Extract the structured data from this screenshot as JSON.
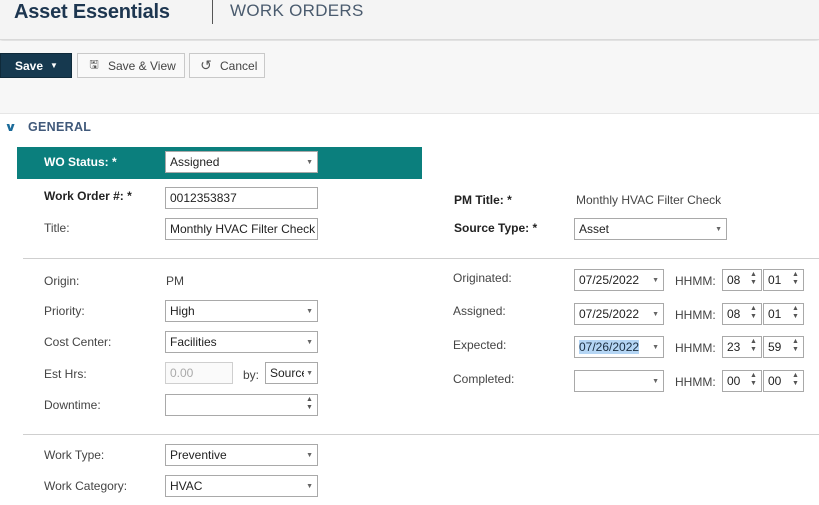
{
  "header": {
    "brand": "Asset Essentials",
    "module": "WORK ORDERS"
  },
  "toolbar": {
    "save": "Save",
    "save_view": "Save & View",
    "cancel": "Cancel"
  },
  "section": {
    "title": "GENERAL"
  },
  "form": {
    "wo_status": {
      "label": "WO Status: *",
      "value": "Assigned"
    },
    "work_order_no": {
      "label": "Work Order #: *",
      "value": "0012353837"
    },
    "title": {
      "label": "Title:",
      "value": "Monthly HVAC Filter Check"
    },
    "pm_title": {
      "label": "PM Title: *",
      "value": "Monthly HVAC Filter Check"
    },
    "source_type": {
      "label": "Source Type: *",
      "value": "Asset"
    },
    "origin": {
      "label": "Origin:",
      "value": "PM"
    },
    "priority": {
      "label": "Priority:",
      "value": "High"
    },
    "cost_center": {
      "label": "Cost Center:",
      "value": "Facilities"
    },
    "est_hrs": {
      "label": "Est Hrs:",
      "placeholder": "0.00",
      "by_label": "by:",
      "by_value": "Source"
    },
    "downtime": {
      "label": "Downtime:",
      "value": ""
    },
    "originated": {
      "label": "Originated:",
      "date": "07/25/2022",
      "hhmm_label": "HHMM:",
      "hh": "08",
      "mm": "01"
    },
    "assigned": {
      "label": "Assigned:",
      "date": "07/25/2022",
      "hhmm_label": "HHMM:",
      "hh": "08",
      "mm": "01"
    },
    "expected": {
      "label": "Expected:",
      "date": "07/26/2022",
      "hhmm_label": "HHMM:",
      "hh": "23",
      "mm": "59"
    },
    "completed": {
      "label": "Completed:",
      "date": "",
      "hhmm_label": "HHMM:",
      "hh": "00",
      "mm": "00"
    },
    "work_type": {
      "label": "Work Type:",
      "value": "Preventive"
    },
    "work_category": {
      "label": "Work Category:",
      "value": "HVAC"
    }
  },
  "icons": {
    "save_view": "save-disk-icon",
    "cancel": "undo-icon",
    "dropdown": "chevron-down-icon",
    "section": "chevron-down-icon"
  }
}
